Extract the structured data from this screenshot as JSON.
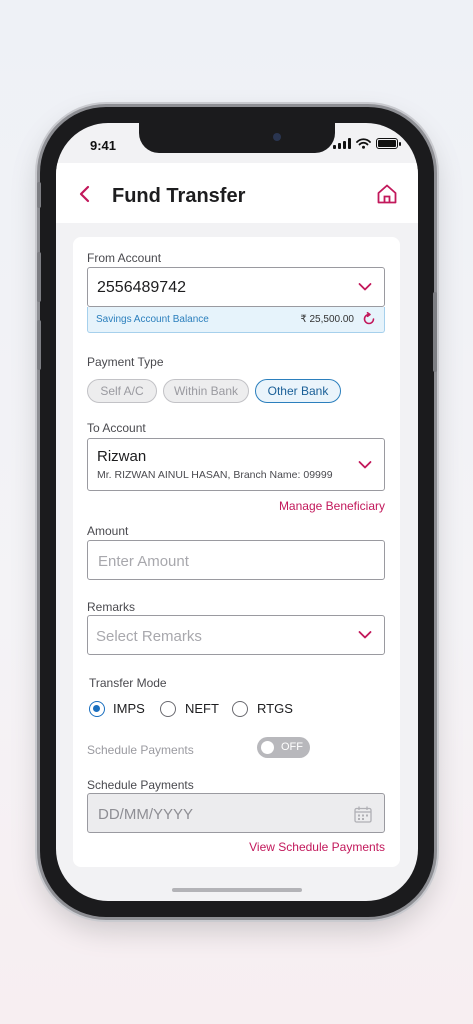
{
  "status_bar": {
    "time": "9:41"
  },
  "header": {
    "title": "Fund Transfer"
  },
  "from_account": {
    "label": "From Account",
    "account_number": "2556489742",
    "balance_label": "Savings Account Balance",
    "balance_value": "₹ 25,500.00"
  },
  "payment_type": {
    "label": "Payment Type",
    "options": [
      "Self A/C",
      "Within Bank",
      "Other Bank"
    ],
    "selected": "Other Bank"
  },
  "to_account": {
    "label": "To Account",
    "name": "Rizwan",
    "details": "Mr. RIZWAN AINUL HASAN, Branch Name: 09999",
    "manage_link": "Manage Beneficiary"
  },
  "amount": {
    "label": "Amount",
    "placeholder": "Enter Amount"
  },
  "remarks": {
    "label": "Remarks",
    "placeholder": "Select Remarks"
  },
  "transfer_mode": {
    "label": "Transfer Mode",
    "options": [
      "IMPS",
      "NEFT",
      "RTGS"
    ],
    "selected": "IMPS"
  },
  "schedule_toggle": {
    "label": "Schedule Payments",
    "state": "OFF"
  },
  "schedule_date": {
    "label": "Schedule Payments",
    "placeholder": "DD/MM/YYYY",
    "view_link": "View Schedule Payments"
  },
  "colors": {
    "accent": "#c2185b",
    "primary_blue": "#1a6fbf",
    "balance_bg": "#e6f3fb"
  }
}
